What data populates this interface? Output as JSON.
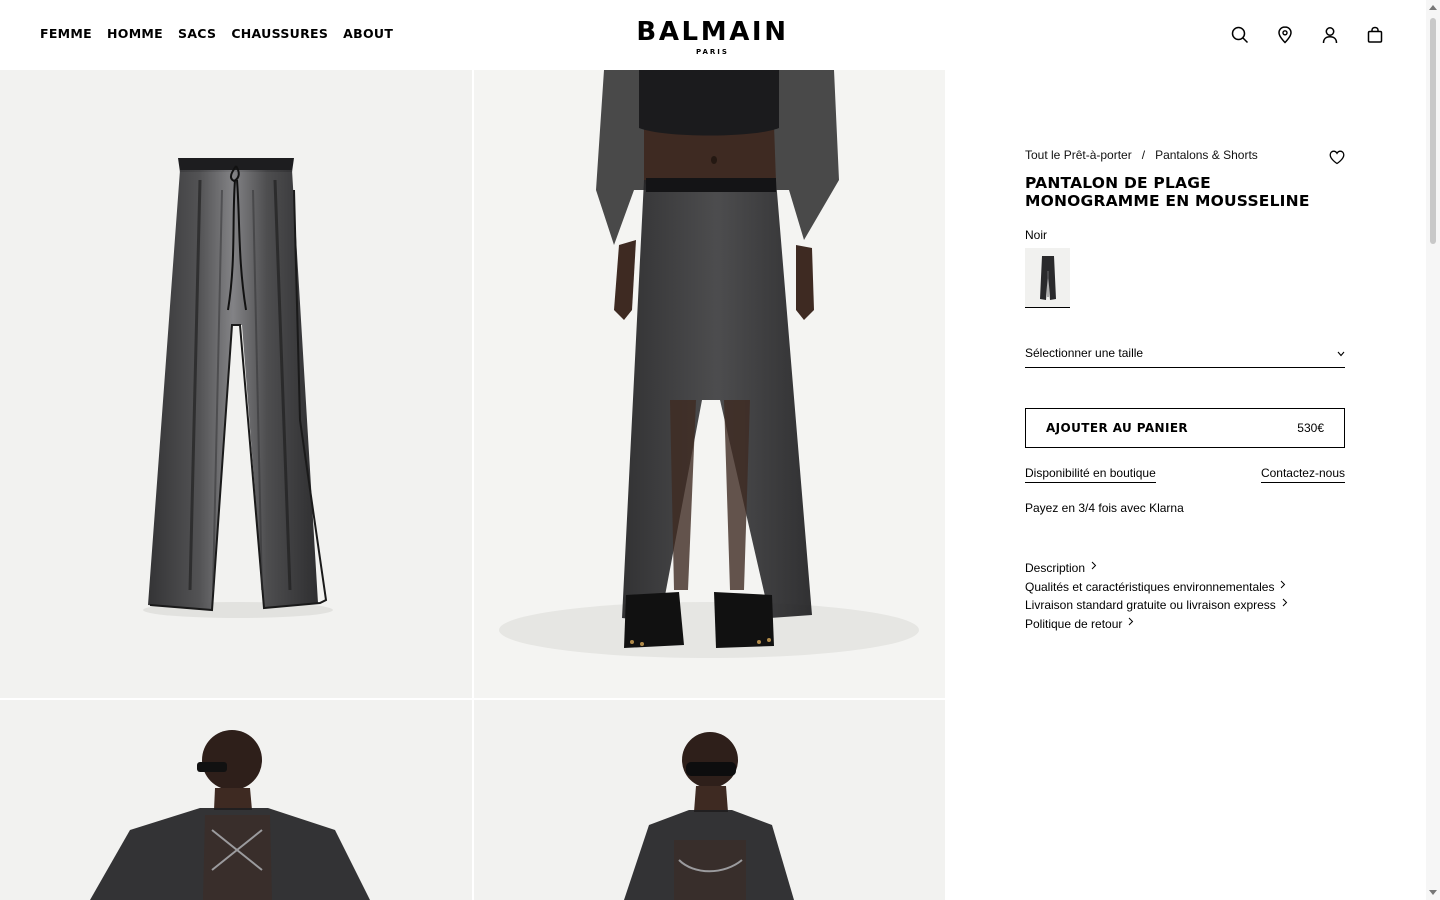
{
  "nav": {
    "items": [
      "FEMME",
      "HOMME",
      "SACS",
      "CHAUSSURES",
      "ABOUT"
    ]
  },
  "logo": {
    "brand": "BALMAIN",
    "city": "PARIS"
  },
  "header_icons": [
    "search-icon",
    "location-pin-icon",
    "user-icon",
    "shopping-bag-icon"
  ],
  "product": {
    "breadcrumb": [
      "Tout le Prêt-à-porter",
      "Pantalons & Shorts"
    ],
    "breadcrumb_sep": "/",
    "title": "PANTALON DE PLAGE MONOGRAMME EN MOUSSELINE",
    "color": "Noir",
    "size_placeholder": "Sélectionner une taille",
    "add_to_cart": "AJOUTER AU PANIER",
    "price": "530€",
    "store_availability": "Disponibilité en boutique",
    "contact": "Contactez-nous",
    "klarna": "Payez en 3/4 fois avec Klarna",
    "info": [
      "Description",
      "Qualités et caractéristiques environnementales",
      "Livraison standard gratuite ou livraison express",
      "Politique de retour"
    ]
  },
  "colors": {
    "fabric": "#1c1c1e",
    "background": "#f2f2f0",
    "skin": "#3e2a22"
  }
}
